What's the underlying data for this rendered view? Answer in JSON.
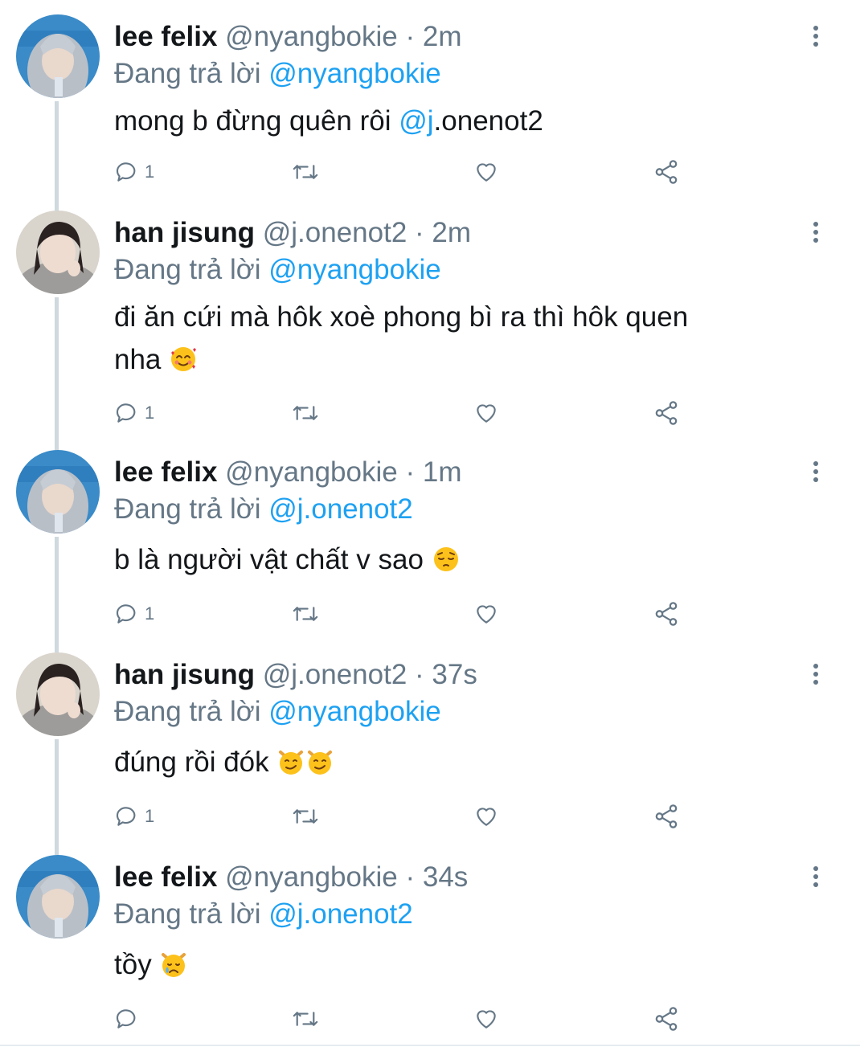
{
  "tweets": [
    {
      "name": "lee felix",
      "handle": "@nyangbokie",
      "dot": "·",
      "time": "2m",
      "reply_prefix": "Đang trả lời",
      "reply_to": "@nyangbokie",
      "text_before": "mong b đừng quên rôi ",
      "text_mention": "@j",
      "text_after": ".onenot2",
      "reply_count": "1",
      "avatar": "lee-felix-avatar"
    },
    {
      "name": "han jisung",
      "handle": "@j.onenot2",
      "dot": "·",
      "time": "2m",
      "reply_prefix": "Đang trả lời",
      "reply_to": "@nyangbokie",
      "text_line1": "đi ăn cứi mà hôk xoè phong bì ra thì hôk quen",
      "text_line2": "nha",
      "emoji": "smiling-face-with-hearts",
      "reply_count": "1",
      "avatar": "han-jisung-avatar"
    },
    {
      "name": "lee felix",
      "handle": "@nyangbokie",
      "dot": "·",
      "time": "1m",
      "reply_prefix": "Đang trả lời",
      "reply_to": "@j.onenot2",
      "text": "b là người vật chất v sao",
      "emoji": "pensive-face",
      "reply_count": "1",
      "avatar": "lee-felix-avatar"
    },
    {
      "name": "han jisung",
      "handle": "@j.onenot2",
      "dot": "·",
      "time": "37s",
      "reply_prefix": "Đang trả lời",
      "reply_to": "@nyangbokie",
      "text": "đúng rồi đók",
      "emoji": "smirking-cat",
      "reply_count": "1",
      "avatar": "han-jisung-avatar"
    },
    {
      "name": "lee felix",
      "handle": "@nyangbokie",
      "dot": "·",
      "time": "34s",
      "reply_prefix": "Đang trả lời",
      "reply_to": "@j.onenot2",
      "text": "tồy",
      "emoji": "crying-cat",
      "reply_count": "",
      "avatar": "lee-felix-avatar"
    }
  ],
  "colors": {
    "text": "#14171a",
    "secondary": "#657786",
    "link": "#1da1f2",
    "thread": "#cfd9de"
  },
  "icons": [
    "reply-icon",
    "retweet-icon",
    "like-icon",
    "share-icon",
    "more-icon"
  ]
}
